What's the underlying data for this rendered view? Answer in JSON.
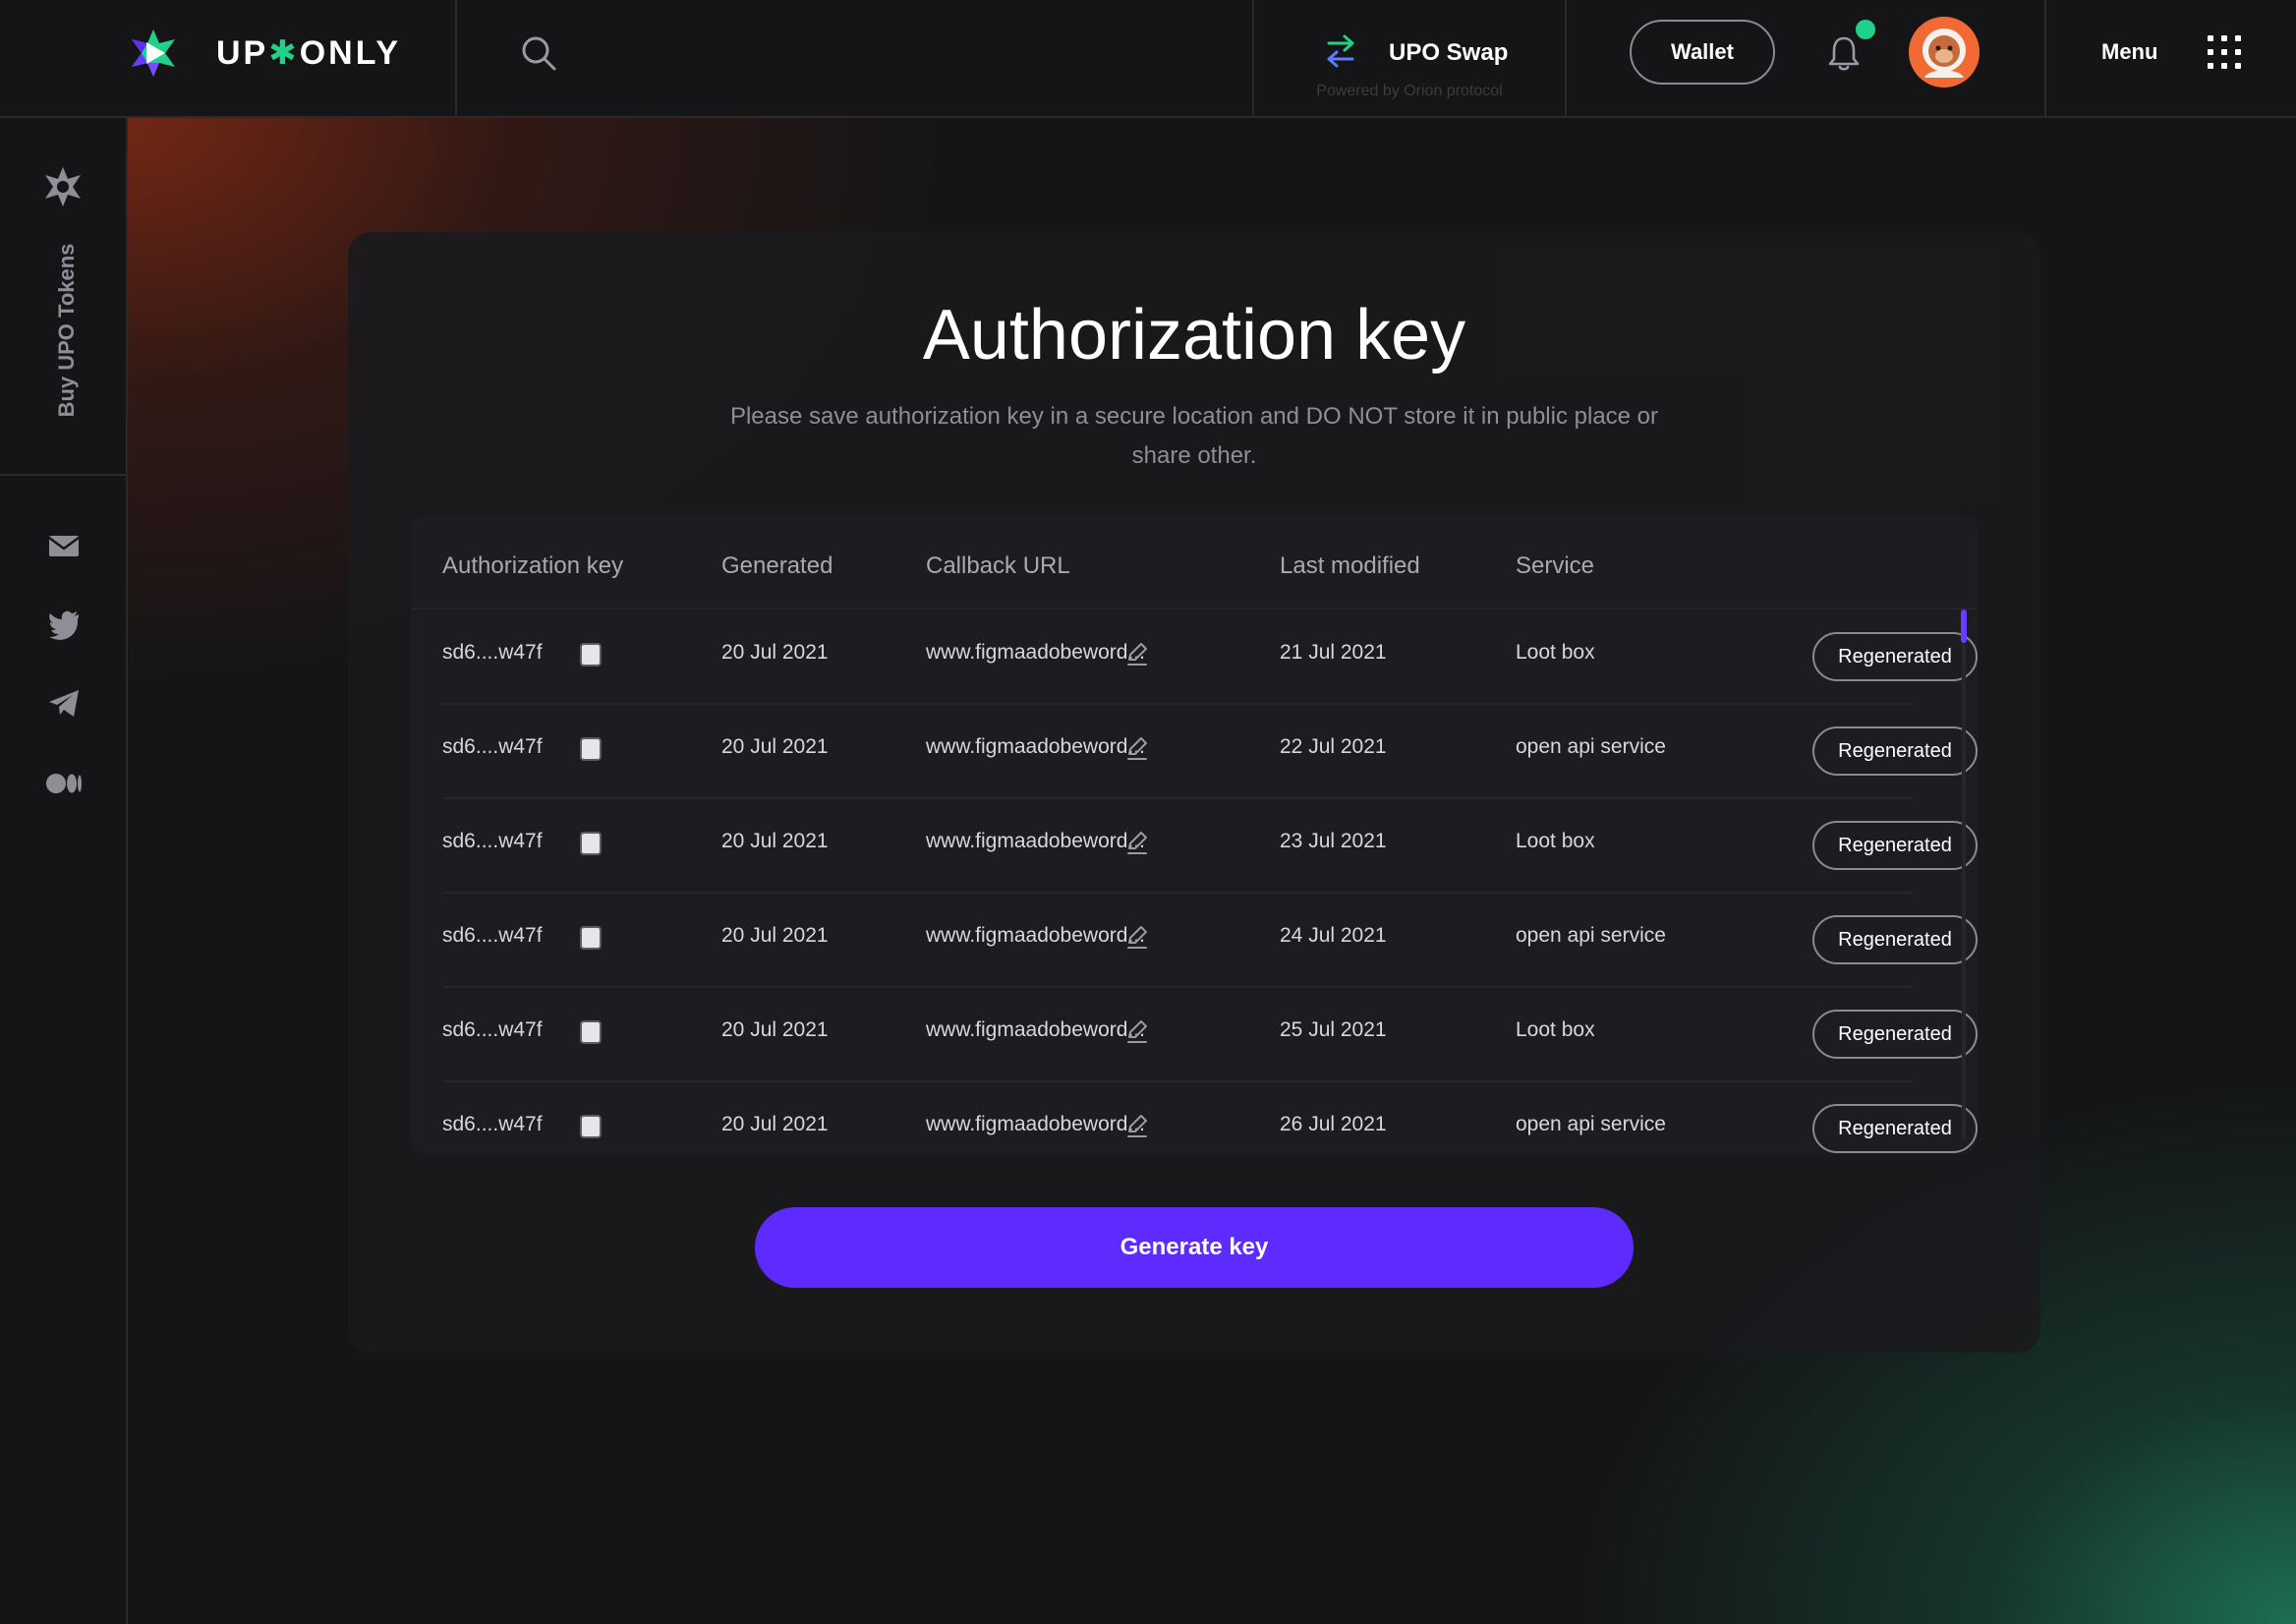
{
  "brand": {
    "name_left": "UP",
    "name_right": "ONLY"
  },
  "header": {
    "swap_label": "UPO Swap",
    "swap_sub": "Powered by Orion protocol",
    "wallet_label": "Wallet",
    "menu_label": "Menu",
    "has_notification": true
  },
  "sidebar": {
    "buy_tokens_label": "Buy UPO Tokens",
    "social": [
      "mail-icon",
      "twitter-icon",
      "telegram-icon",
      "medium-icon"
    ]
  },
  "main": {
    "title": "Authorization key",
    "subtitle": "Please save authorization key in a secure location and DO NOT store it in public place or share other."
  },
  "table": {
    "headers": [
      "Authorization key",
      "Generated",
      "Callback URL",
      "Last modified",
      "Service"
    ],
    "rows": [
      {
        "key": "sd6....w47f",
        "generated": "20 Jul 2021",
        "callback": "www.figmaadobeword...",
        "modified": "21 Jul 2021",
        "service": "Loot box",
        "action": "Regenerated"
      },
      {
        "key": "sd6....w47f",
        "generated": "20 Jul 2021",
        "callback": "www.figmaadobeword...",
        "modified": "22 Jul 2021",
        "service": "open api service",
        "action": "Regenerated"
      },
      {
        "key": "sd6....w47f",
        "generated": "20 Jul 2021",
        "callback": "www.figmaadobeword...",
        "modified": "23 Jul 2021",
        "service": "Loot box",
        "action": "Regenerated"
      },
      {
        "key": "sd6....w47f",
        "generated": "20 Jul 2021",
        "callback": "www.figmaadobeword...",
        "modified": "24 Jul 2021",
        "service": "open api service",
        "action": "Regenerated"
      },
      {
        "key": "sd6....w47f",
        "generated": "20 Jul 2021",
        "callback": "www.figmaadobeword...",
        "modified": "25 Jul 2021",
        "service": "Loot box",
        "action": "Regenerated"
      },
      {
        "key": "sd6....w47f",
        "generated": "20 Jul 2021",
        "callback": "www.figmaadobeword...",
        "modified": "26 Jul 2021",
        "service": "open api service",
        "action": "Regenerated"
      }
    ]
  },
  "actions": {
    "generate_label": "Generate key"
  },
  "colors": {
    "accent": "#5e2bff",
    "brand_green": "#1ed389",
    "background": "#151517"
  }
}
